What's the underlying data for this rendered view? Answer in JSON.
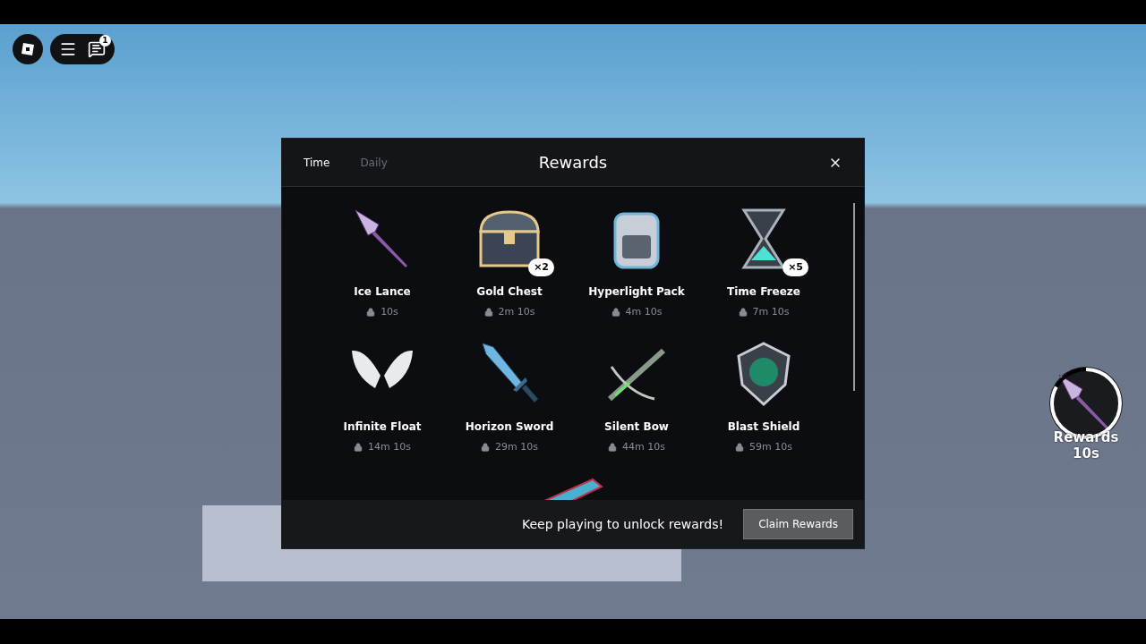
{
  "hud": {
    "chat_badge": "1"
  },
  "rewards_dialog": {
    "title": "Rewards",
    "tabs": [
      {
        "label": "Time",
        "selected": true
      },
      {
        "label": "Daily",
        "selected": false
      }
    ],
    "items": [
      {
        "kind": "spear",
        "name": "Ice Lance",
        "time": "10s"
      },
      {
        "kind": "chest",
        "name": "Gold Chest",
        "time": "2m 10s",
        "badge": "×2"
      },
      {
        "kind": "backpack",
        "name": "Hyperlight Pack",
        "time": "4m 10s"
      },
      {
        "kind": "hourglass",
        "name": "Time Freeze",
        "time": "7m 10s",
        "badge": "×5"
      },
      {
        "kind": "wings",
        "name": "Infinite Float",
        "time": "14m 10s"
      },
      {
        "kind": "sword",
        "name": "Horizon Sword",
        "time": "29m 10s"
      },
      {
        "kind": "crossbow",
        "name": "Silent Bow",
        "time": "44m 10s"
      },
      {
        "kind": "shield",
        "name": "Blast Shield",
        "time": "59m 10s"
      },
      {
        "kind": "blaster"
      }
    ],
    "footer_message": "Keep playing to unlock rewards!",
    "claim_button": "Claim Rewards"
  },
  "rewards_widget": {
    "label": "Rewards",
    "time": "10s",
    "level": 0.83
  }
}
